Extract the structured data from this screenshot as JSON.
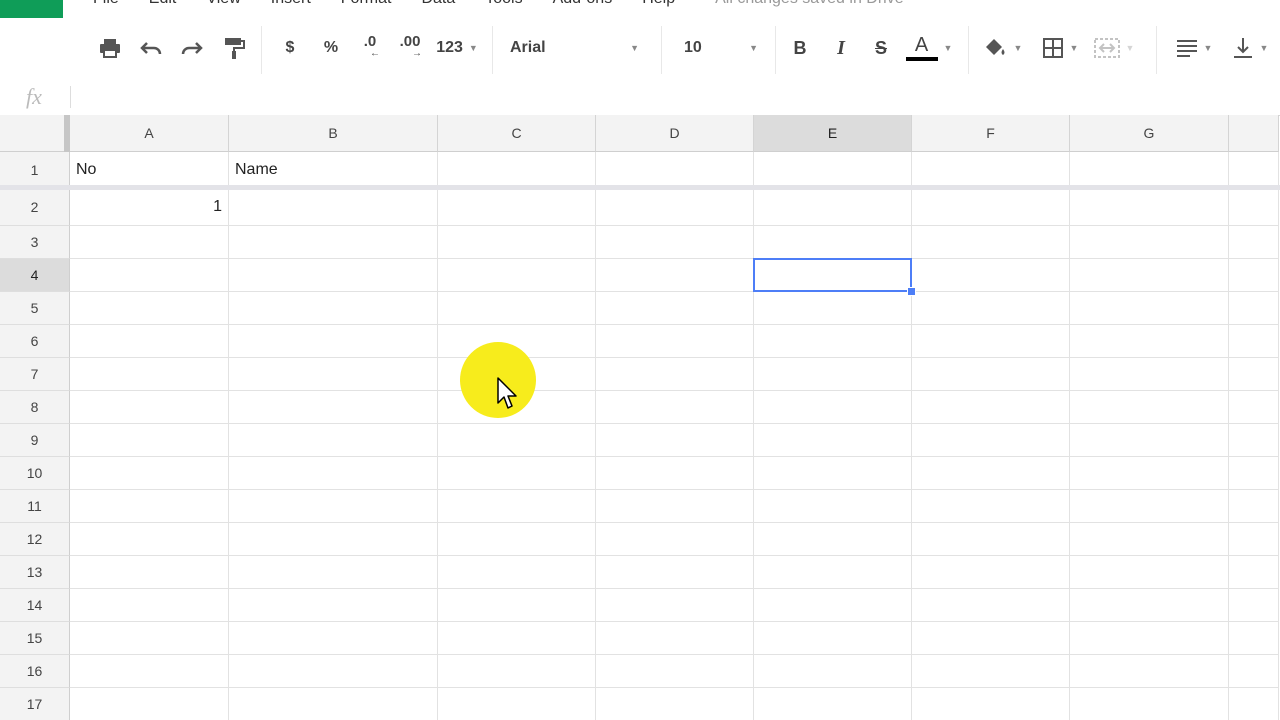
{
  "menu": {
    "items": [
      "File",
      "Edit",
      "View",
      "Insert",
      "Format",
      "Data",
      "Tools",
      "Add-ons",
      "Help"
    ],
    "save_status": "All changes saved in Drive"
  },
  "toolbar": {
    "currency": "$",
    "percent": "%",
    "decrease_decimals": ".0",
    "increase_decimals": ".00",
    "more_formats": "123",
    "font_family": "Arial",
    "font_size": "10",
    "bold": "B",
    "italic": "I",
    "strikethrough": "S",
    "text_color": "A",
    "text_color_swatch": "#000000"
  },
  "formula_bar": {
    "fx_label": "fx",
    "value": ""
  },
  "grid": {
    "columns": [
      "A",
      "B",
      "C",
      "D",
      "E",
      "F",
      "G"
    ],
    "rows": [
      "1",
      "2",
      "3",
      "4",
      "5",
      "6",
      "7",
      "8",
      "9",
      "10",
      "11",
      "12",
      "13",
      "14",
      "15",
      "16",
      "17"
    ],
    "active_cell": "E4",
    "active_column": "E",
    "active_row": "4",
    "selection_color": "#4d7ef7",
    "cells": {
      "A1": "No",
      "B1": "Name",
      "A2": "1"
    }
  },
  "colors": {
    "brand_green": "#0f9d58",
    "cursor_highlight": "#f7ec1c"
  }
}
